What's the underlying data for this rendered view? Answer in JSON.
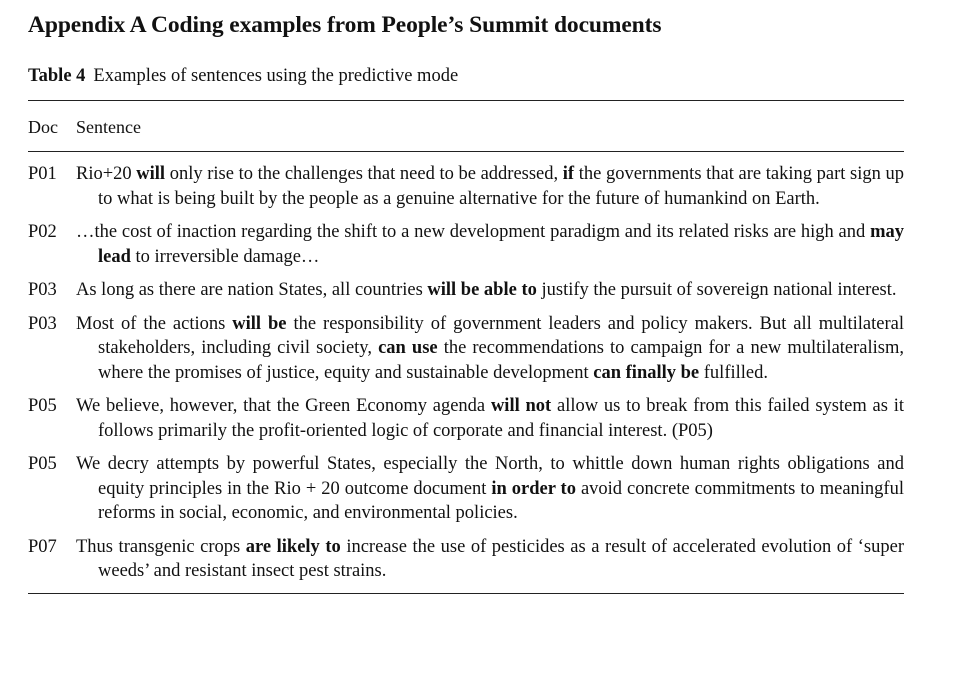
{
  "appendix_title": "Appendix A Coding examples from People’s Summit documents",
  "table": {
    "number": "Table 4",
    "caption": "Examples of sentences using the predictive mode",
    "headers": {
      "doc": "Doc",
      "sentence": "Sentence"
    },
    "rows": [
      {
        "doc": "P01",
        "segments": [
          {
            "t": "Rio+20 "
          },
          {
            "t": "will",
            "b": true
          },
          {
            "t": " only rise to the challenges that need to be addressed, "
          },
          {
            "t": "if",
            "b": true
          },
          {
            "t": " the governments that are taking part sign up to what is being built by the people as a genuine alternative for the future of humankind on Earth."
          }
        ]
      },
      {
        "doc": "P02",
        "segments": [
          {
            "t": "…the cost of inaction regarding the shift to a new development paradigm and its related risks are high and "
          },
          {
            "t": "may lead",
            "b": true
          },
          {
            "t": " to irreversible damage…"
          }
        ]
      },
      {
        "doc": "P03",
        "segments": [
          {
            "t": "As long as there are nation States, all countries "
          },
          {
            "t": "will be able to",
            "b": true
          },
          {
            "t": " justify the pursuit of sovereign national interest."
          }
        ]
      },
      {
        "doc": "P03",
        "segments": [
          {
            "t": "Most of the actions "
          },
          {
            "t": "will be",
            "b": true
          },
          {
            "t": " the responsibility of government leaders and policy makers. But all multilateral stakeholders, including civil society, "
          },
          {
            "t": "can use",
            "b": true
          },
          {
            "t": " the recommendations to campaign for a new multilateralism, where the promises of justice, equity and sustainable development "
          },
          {
            "t": "can finally be",
            "b": true
          },
          {
            "t": " fulfilled."
          }
        ]
      },
      {
        "doc": "P05",
        "segments": [
          {
            "t": "We believe, however, that the Green Economy agenda "
          },
          {
            "t": "will not",
            "b": true
          },
          {
            "t": " allow us to break from this failed system as it follows primarily the profit-oriented logic of corporate and financial interest. (P05)"
          }
        ]
      },
      {
        "doc": "P05",
        "segments": [
          {
            "t": "We decry attempts by powerful States, especially the North, to whittle down human rights obligations and equity principles in the Rio + 20 outcome document "
          },
          {
            "t": "in order to",
            "b": true
          },
          {
            "t": " avoid concrete commitments to meaningful reforms in social, economic, and environmental policies."
          }
        ]
      },
      {
        "doc": "P07",
        "segments": [
          {
            "t": "Thus transgenic crops "
          },
          {
            "t": "are likely to",
            "b": true
          },
          {
            "t": " increase the use of pesticides as a result of accelerated evolution of ‘super weeds’ and resistant insect pest strains."
          }
        ]
      }
    ]
  }
}
